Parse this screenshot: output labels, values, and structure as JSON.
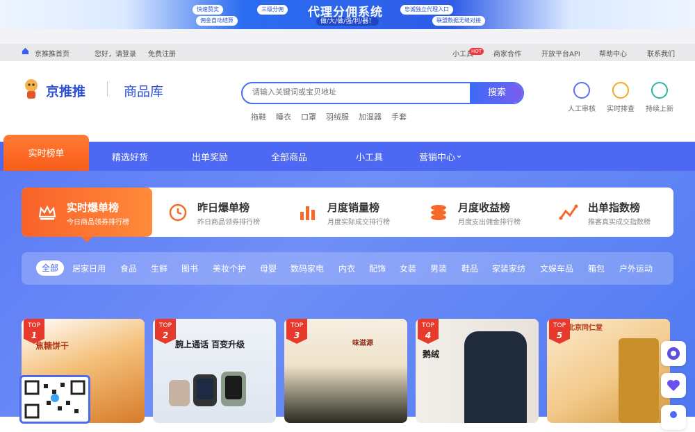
{
  "banner": {
    "title": "代理分佣系统",
    "subtitle": "做/大/做/强/利/器！",
    "pills": [
      "快速赞奖",
      "三级分佣",
      "佣金自动结算",
      "忠诚独立代理入口",
      "联盟数据无缝对接"
    ]
  },
  "topbar": {
    "home": "京推推首页",
    "greet": "您好，请登录",
    "register": "免费注册",
    "tools": "小工具",
    "hot": "HOT",
    "cooperation": "商家合作",
    "api": "开放平台API",
    "help": "帮助中心",
    "contact": "联系我们"
  },
  "header": {
    "brand": "京推推",
    "library": "商品库",
    "search_placeholder": "请输入关键词或宝贝地址",
    "search_button": "搜索",
    "hot_words": [
      "拖鞋",
      "睡衣",
      "口罩",
      "羽绒服",
      "加湿器",
      "手套"
    ],
    "icons": [
      {
        "label": "人工审核",
        "icon": "user-review-icon"
      },
      {
        "label": "实时排查",
        "icon": "search-check-icon"
      },
      {
        "label": "持续上新",
        "icon": "new-tag-icon"
      }
    ]
  },
  "nav": {
    "items": [
      "实时榜单",
      "精选好货",
      "出单奖励",
      "全部商品",
      "小工具",
      "营销中心"
    ]
  },
  "ranks": [
    {
      "title": "实时爆单榜",
      "sub": "今日商品领券排行榜",
      "icon": "crown-icon"
    },
    {
      "title": "昨日爆单榜",
      "sub": "昨日商品领券排行榜",
      "icon": "clock-icon"
    },
    {
      "title": "月度销量榜",
      "sub": "月度实际成交排行榜",
      "icon": "bar-chart-icon"
    },
    {
      "title": "月度收益榜",
      "sub": "月度支出佣金排行榜",
      "icon": "coins-icon"
    },
    {
      "title": "出单指数榜",
      "sub": "推客真实成交指数榜",
      "icon": "trend-icon"
    }
  ],
  "categories": [
    "全部",
    "居家日用",
    "食品",
    "生鲜",
    "图书",
    "美妆个护",
    "母婴",
    "数码家电",
    "内衣",
    "配饰",
    "女装",
    "男装",
    "鞋品",
    "家装家纺",
    "文娱车品",
    "箱包",
    "户外运动"
  ],
  "products": [
    {
      "rank": "1",
      "tag": "TOP",
      "theme": "#f0a04b",
      "caption": "焦糖饼干"
    },
    {
      "rank": "2",
      "tag": "TOP",
      "theme": "#e9eef5",
      "caption": "腕上通话 百变升级"
    },
    {
      "rank": "3",
      "tag": "TOP",
      "theme": "#f3e7d3",
      "caption": "味滋源"
    },
    {
      "rank": "4",
      "tag": "TOP",
      "theme": "#e4dfd9",
      "caption": "鹅绒"
    },
    {
      "rank": "5",
      "tag": "TOP",
      "theme": "#f6e2b8",
      "caption": "北京同仁堂"
    }
  ]
}
